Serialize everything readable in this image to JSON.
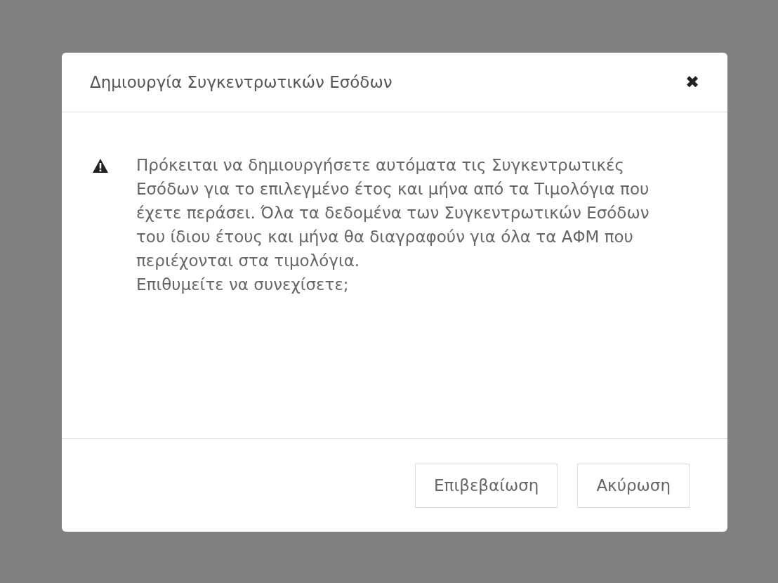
{
  "dialog": {
    "title": "Δημιουργία Συγκεντρωτικών Εσόδων",
    "close": "✖",
    "message": [
      "Πρόκειται να δημιουργήσετε αυτόματα τις Συγκεντρωτικές Εσόδων για το επιλεγμένο έτος και μήνα από τα Τιμολόγια που έχετε περάσει. Όλα τα δεδομένα των Συγκεντρωτικών Εσόδων του ίδιου έτους και μήνα θα διαγραφούν για όλα τα ΑΦΜ που περιέχονται στα τιμολόγια.",
      "Επιθυμείτε να συνεχίσετε;"
    ],
    "buttons": [
      "Επιβεβαίωση",
      "Ακύρωση"
    ]
  }
}
